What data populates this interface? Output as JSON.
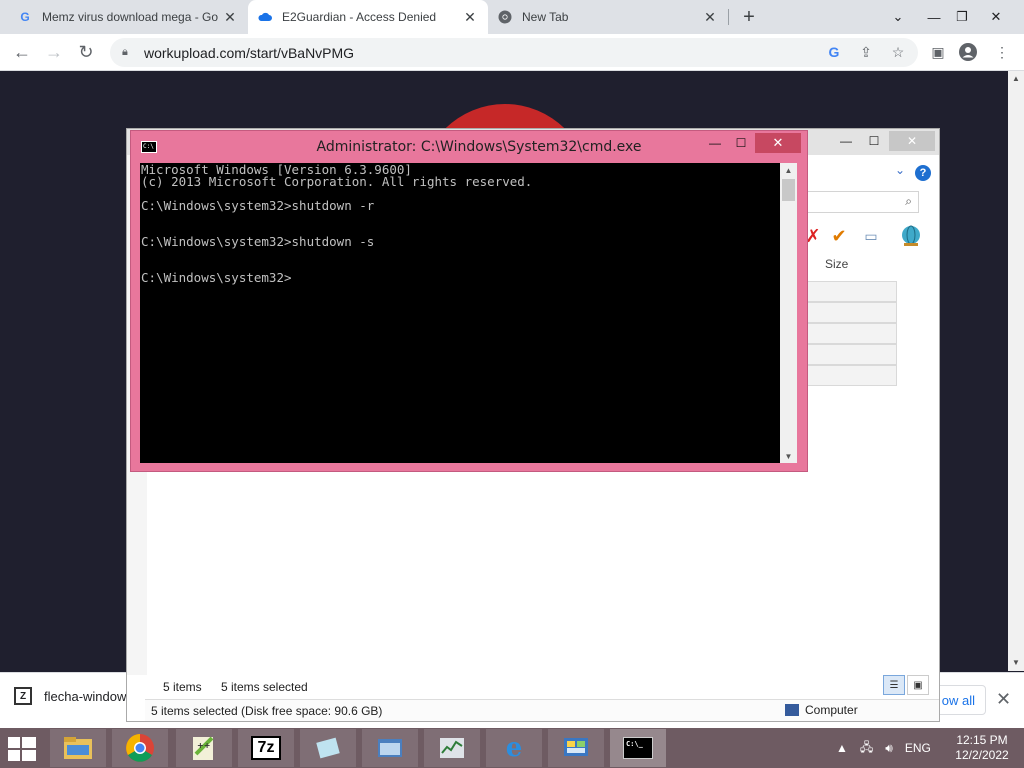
{
  "browser": {
    "tabs": [
      {
        "title": "Memz virus download mega - Go",
        "favicon": "google-icon"
      },
      {
        "title": "E2Guardian - Access Denied",
        "favicon": "cloud-icon"
      },
      {
        "title": "New Tab",
        "favicon": "chrome-icon"
      }
    ],
    "url": "workupload.com/start/vBaNvPMG"
  },
  "cmd_window": {
    "title": "Administrator: C:\\Windows\\System32\\cmd.exe",
    "icon_text": "C:\\",
    "lines": [
      "Microsoft Windows [Version 6.3.9600]",
      "(c) 2013 Microsoft Corporation. All rights reserved.",
      "",
      "C:\\Windows\\system32>shutdown -r",
      "",
      "",
      "C:\\Windows\\system32>shutdown -s",
      "",
      "",
      "C:\\Windows\\system32>"
    ]
  },
  "explorer": {
    "column_size": "Size",
    "items_count": "5 items",
    "items_selected": "5 items selected",
    "status_bar": "5 items selected (Disk free space: 90.6 GB)",
    "location": "Computer"
  },
  "download_shelf": {
    "filename": "flecha-windows.",
    "show_all": "ow all"
  },
  "taskbar": {
    "apps": [
      "file-explorer",
      "chrome",
      "notepad-plus-plus",
      "7zip",
      "paint",
      "window-app",
      "task-manager",
      "internet-explorer",
      "control-panel",
      "cmd"
    ],
    "tray_lang": "ENG",
    "time": "12:15 PM",
    "date": "12/2/2022"
  }
}
